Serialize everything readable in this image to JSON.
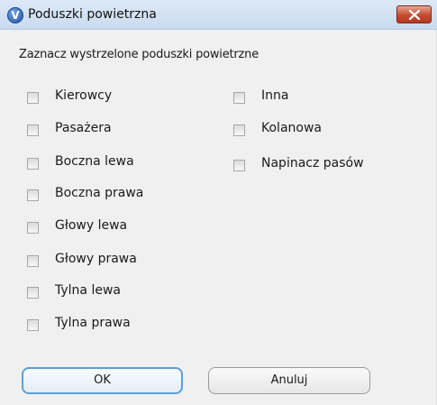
{
  "window": {
    "title": "Poduszki powietrzna",
    "icon": "v-logo-icon",
    "close_icon": "close-x-icon"
  },
  "instruction": "Zaznacz wystrzelone poduszki powietrzne",
  "checkboxes_left": [
    {
      "label": "Kierowcy",
      "checked": false
    },
    {
      "label": "Pasażera",
      "checked": false
    },
    {
      "label": "Boczna lewa",
      "checked": false
    },
    {
      "label": "Boczna prawa",
      "checked": false
    },
    {
      "label": "Głowy lewa",
      "checked": false
    },
    {
      "label": "Głowy prawa",
      "checked": false
    },
    {
      "label": "Tylna lewa",
      "checked": false
    },
    {
      "label": "Tylna prawa",
      "checked": false
    }
  ],
  "checkboxes_right": [
    {
      "label": "Inna",
      "checked": false
    },
    {
      "label": "Kolanowa",
      "checked": false
    },
    {
      "label": "Napinacz pasów",
      "checked": false
    }
  ],
  "buttons": {
    "ok": "OK",
    "cancel": "Anuluj"
  },
  "colors": {
    "accent": "#5c9fd6",
    "close": "#c44b2f"
  }
}
